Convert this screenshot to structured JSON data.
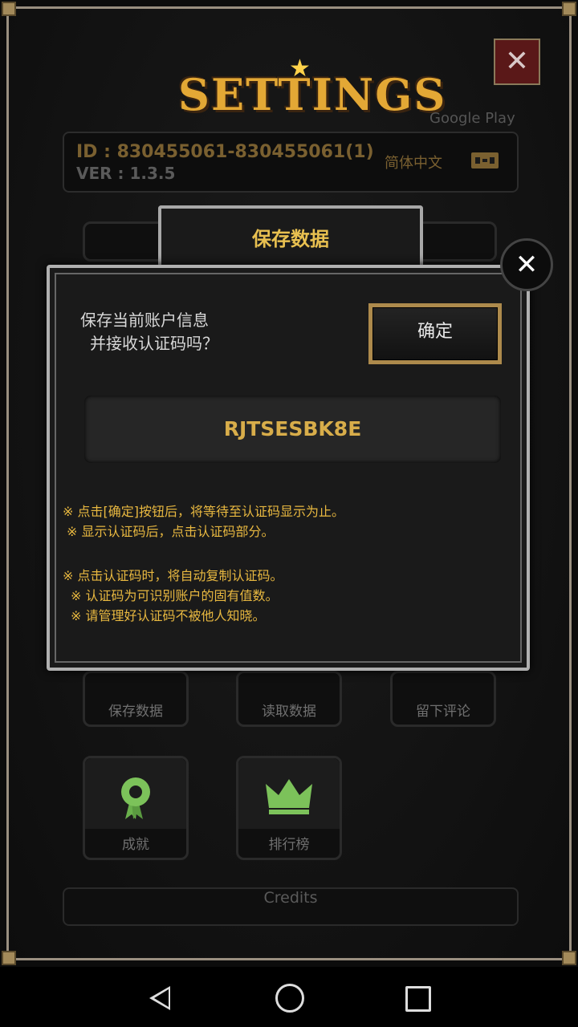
{
  "settings": {
    "title": "SETTINGS",
    "close_label": "✕",
    "store_label": "Google Play",
    "id_text": "ID : 830455061-830455061(1)",
    "version_text": "VER : 1.3.5",
    "language": "简体中文"
  },
  "menu": {
    "row1": [
      "保存数据",
      "读取数据",
      "留下评论"
    ],
    "row2": [
      "成就",
      "排行榜"
    ],
    "credits": "Credits"
  },
  "dialog": {
    "tab_title": "保存数据",
    "close_label": "✕",
    "question_line1": "保存当前账户信息",
    "question_line2": "并接收认证码吗？",
    "confirm_label": "确定",
    "code": "RJTSESBK8E",
    "notes": [
      "※ 点击[确定]按钮后，将等待至认证码显示为止。",
      "※ 显示认证码后，点击认证码部分。",
      "※ 点击认证码时，将自动复制认证码。",
      "※ 认证码为可识别账户的固有值数。",
      "※ 请管理好认证码不被他人知晓。"
    ]
  },
  "icons": {
    "achievements": "award-ribbon-icon",
    "leaderboard": "crown-icon",
    "language": "language-toggle-icon"
  }
}
